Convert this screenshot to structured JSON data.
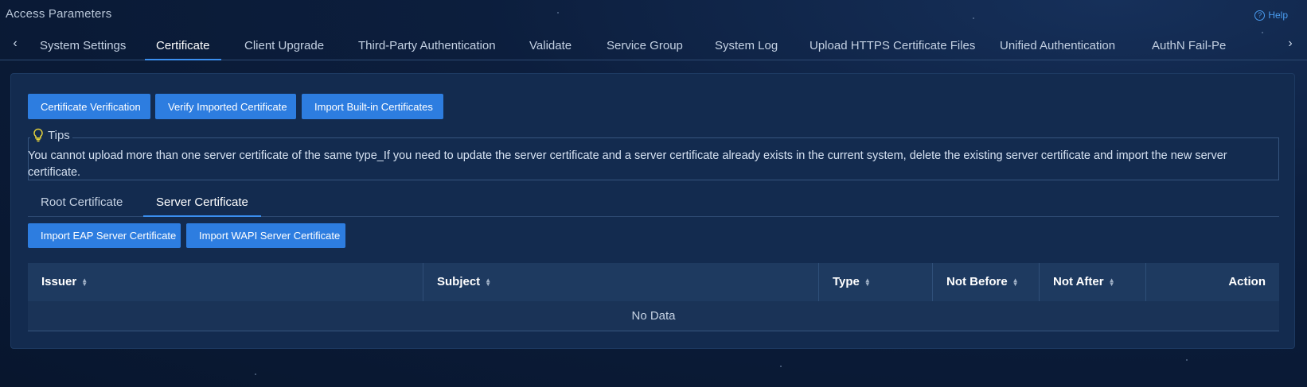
{
  "header": {
    "title": "Access Parameters",
    "help_label": "Help",
    "help_icon": "question-circle-icon"
  },
  "tabs": [
    {
      "label": "System Settings"
    },
    {
      "label": "Certificate",
      "active": true
    },
    {
      "label": "Client Upgrade"
    },
    {
      "label": "Third-Party Authentication"
    },
    {
      "label": "Validate"
    },
    {
      "label": "Service Group"
    },
    {
      "label": "System Log"
    },
    {
      "label": "Upload HTTPS Certificate Files"
    },
    {
      "label": "Unified Authentication"
    },
    {
      "label": "AuthN Fail-Pe"
    }
  ],
  "toolbar": {
    "cert_verification": "Certificate Verification",
    "verify_imported": "Verify Imported Certificate",
    "import_builtin": "Import Built-in Certificates"
  },
  "tips": {
    "title": "Tips",
    "icon": "lightbulb-icon",
    "text": "You cannot upload more than one server certificate of the same type_If you need to update the server certificate and a server certificate already exists in the current system, delete the existing server certificate and import the new server certificate."
  },
  "subtabs": [
    {
      "label": "Root Certificate"
    },
    {
      "label": "Server Certificate",
      "active": true
    }
  ],
  "actions": {
    "import_eap": "Import EAP Server Certificate",
    "import_wapi": "Import WAPI Server Certificate"
  },
  "table": {
    "columns": [
      "Issuer",
      "Subject",
      "Type",
      "Not Before",
      "Not After",
      "Action"
    ],
    "empty_text": "No Data"
  },
  "colors": {
    "accent": "#2d7de0",
    "background": "#0c1e3d",
    "panel": "#132b4f"
  }
}
